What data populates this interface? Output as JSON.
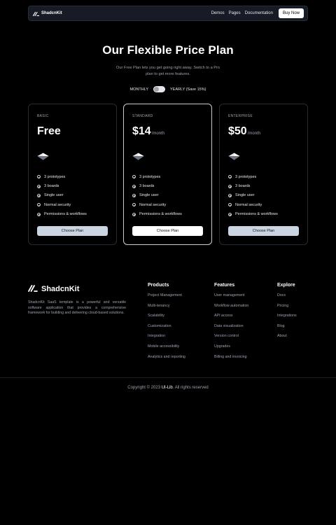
{
  "nav": {
    "brand": "ShadcnKit",
    "links": [
      "Demos",
      "Pages",
      "Documentation"
    ],
    "cta": "Buy Now"
  },
  "hero": {
    "title": "Our Flexible Price Plan",
    "subtitle": "Our Free Plan lets you get going right away. Switch to a Pro plan to get more features."
  },
  "billing": {
    "monthly": "MONTHLY",
    "yearly": "YEARLY (Save 15%)"
  },
  "plans": [
    {
      "name": "BASIC",
      "price": "Free",
      "period": "",
      "features": [
        "3 prototypes",
        "3 boards",
        "Single user",
        "Normal security",
        "Permissions & workflows"
      ],
      "button": "Choose Plan"
    },
    {
      "name": "STANDARD",
      "price": "$14",
      "period": "/month",
      "features": [
        "3 prototypes",
        "3 boards",
        "Single user",
        "Normal security",
        "Permissions & workflows"
      ],
      "button": "Choose Plan"
    },
    {
      "name": "ENTERPRISE",
      "price": "$50",
      "period": "/month",
      "features": [
        "3 prototypes",
        "3 boards",
        "Single user",
        "Normal security",
        "Permissions & workflows"
      ],
      "button": "Choose Plan"
    }
  ],
  "footer": {
    "brand": "ShadcnKit",
    "description": "ShadcnKit SaaS template is a powerful and versatile software application that provides a comprehensive framework for building and delivering cloud-based solutions.",
    "columns": [
      {
        "title": "Products",
        "items": [
          "Project Management",
          "Multi-tenancy",
          "Scalability",
          "Customization",
          "Integration",
          "Mobile accessibility",
          "Analytics and reporting"
        ]
      },
      {
        "title": "Features",
        "items": [
          "User management",
          "Workflow automation",
          "API access",
          "Data visualization",
          "Version control",
          "Upgrades",
          "Billing and invoicing"
        ]
      },
      {
        "title": "Explore",
        "items": [
          "Docs",
          "Pricing",
          "Integrations",
          "Blog",
          "About"
        ]
      }
    ],
    "copyright_prefix": "Copyright © 2023",
    "copyright_link": "UI-Lib",
    "copyright_suffix": ". All rights reserved"
  },
  "icons": {
    "logo": "shadcnkit-logo-icon",
    "plan": "diamond-icon",
    "feature": "check-circle-icon"
  },
  "colors": {
    "background": "#000000",
    "nav_bg": "#161b26",
    "button": "#cbd5e1",
    "muted_text": "#9ca3af"
  }
}
